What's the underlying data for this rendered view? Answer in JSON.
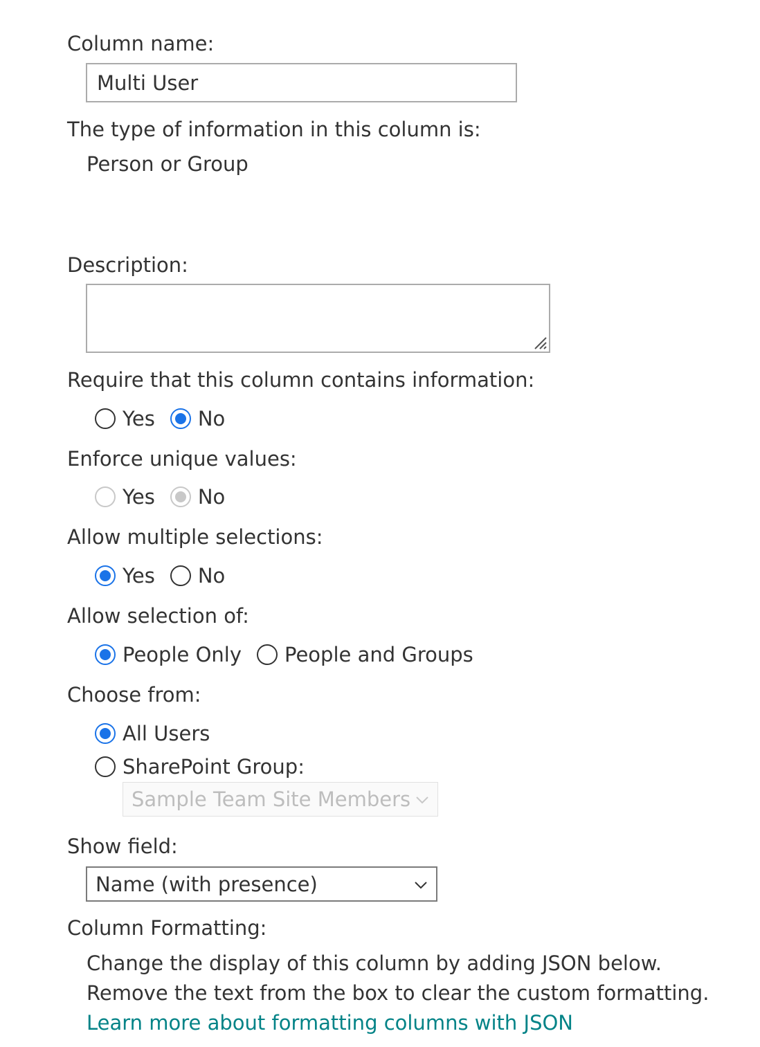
{
  "column_name": {
    "label": "Column name:",
    "value": "Multi User"
  },
  "type": {
    "label": "The type of information in this column is:",
    "value": "Person or Group"
  },
  "description": {
    "label": "Description:",
    "value": ""
  },
  "require": {
    "label": "Require that this column contains information:",
    "options": [
      "Yes",
      "No"
    ],
    "selected": "No"
  },
  "unique": {
    "label": "Enforce unique values:",
    "options": [
      "Yes",
      "No"
    ],
    "selected": "No",
    "disabled": true
  },
  "multiple": {
    "label": "Allow multiple selections:",
    "options": [
      "Yes",
      "No"
    ],
    "selected": "Yes"
  },
  "selection_of": {
    "label": "Allow selection of:",
    "options": [
      "People Only",
      "People and Groups"
    ],
    "selected": "People Only"
  },
  "choose_from": {
    "label": "Choose from:",
    "options": [
      "All Users",
      "SharePoint Group:"
    ],
    "selected": "All Users",
    "group_dropdown": "Sample Team Site Members"
  },
  "show_field": {
    "label": "Show field:",
    "value": "Name (with presence)"
  },
  "formatting": {
    "label": "Column Formatting:",
    "line1": "Change the display of this column by adding JSON below.",
    "line2": "Remove the text from the box to clear the custom formatting.",
    "link": "Learn more about formatting columns with JSON"
  },
  "colors": {
    "accent": "#1a73e8",
    "link": "#038387",
    "text": "#333333",
    "disabled": "#c8c8c8"
  },
  "icons": {
    "dropdown": "chevron-down-icon",
    "resize": "resize-grip-icon"
  }
}
